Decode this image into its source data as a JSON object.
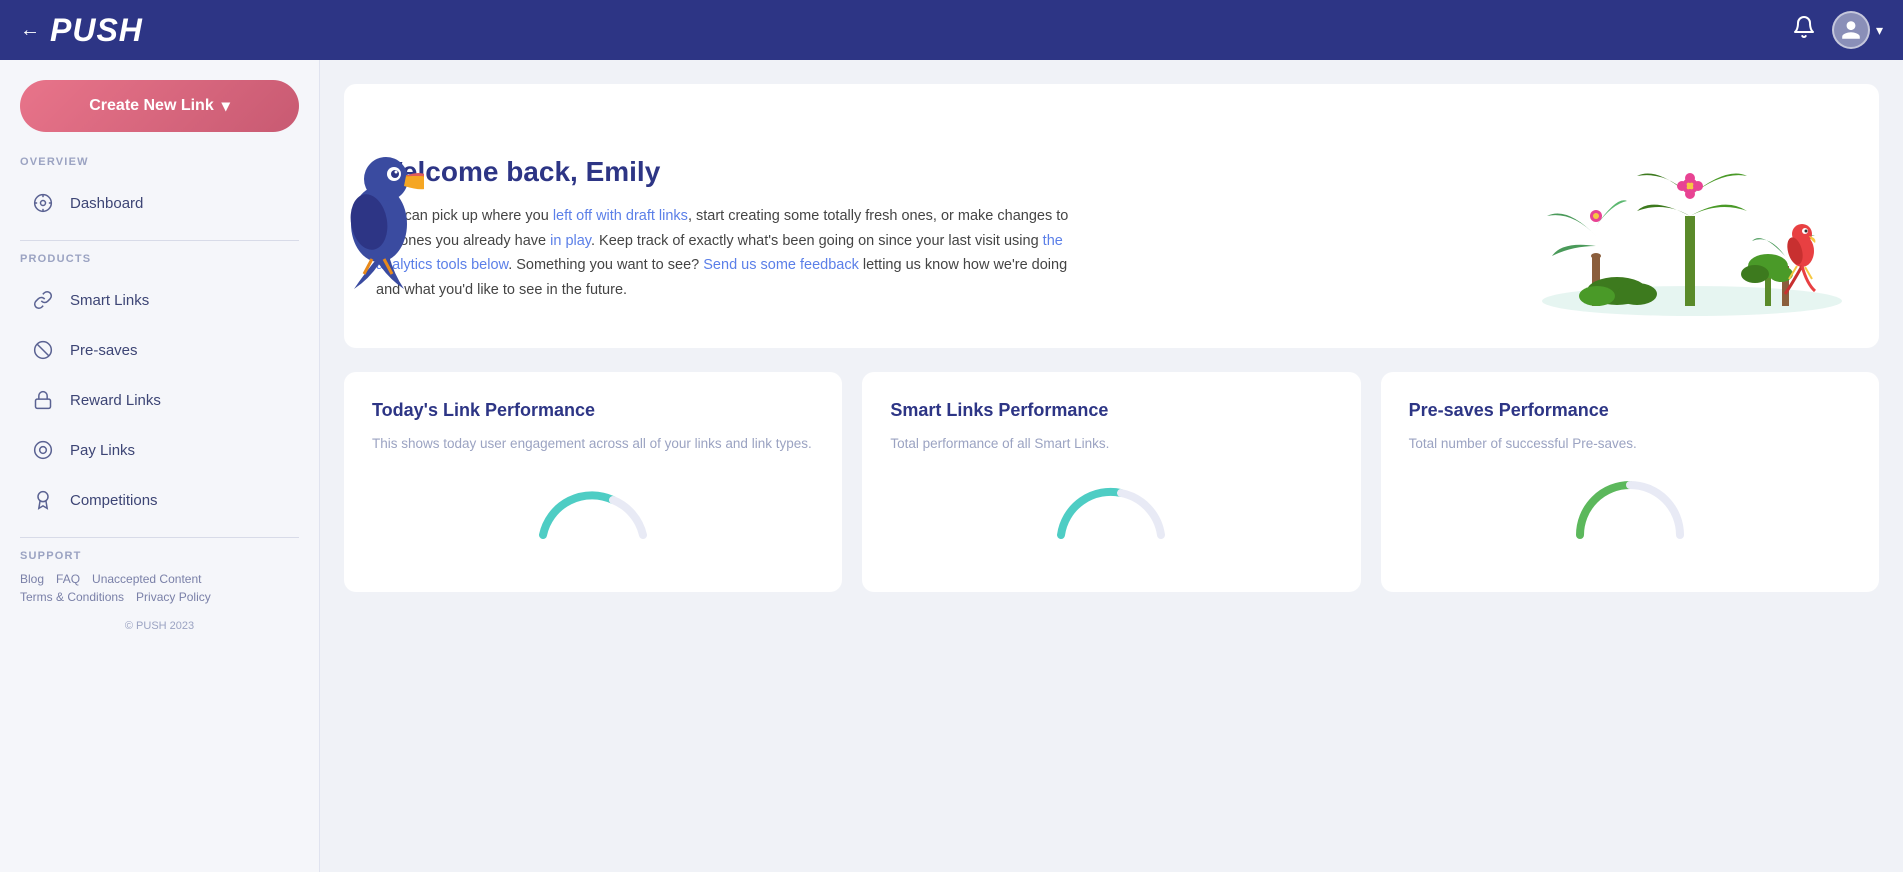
{
  "header": {
    "back_label": "←",
    "logo": "PUSH",
    "bell_icon": "🔔",
    "avatar_icon": "👤",
    "chevron": "▾"
  },
  "sidebar": {
    "create_button_label": "Create New Link",
    "create_chevron": "▾",
    "overview_label": "OVERVIEW",
    "items_overview": [
      {
        "id": "dashboard",
        "label": "Dashboard",
        "icon": "⊙"
      }
    ],
    "products_label": "PRODUCTS",
    "items_products": [
      {
        "id": "smart-links",
        "label": "Smart Links",
        "icon": "🔗"
      },
      {
        "id": "pre-saves",
        "label": "Pre-saves",
        "icon": "⊘"
      },
      {
        "id": "reward-links",
        "label": "Reward Links",
        "icon": "🔒"
      },
      {
        "id": "pay-links",
        "label": "Pay Links",
        "icon": "⊙"
      },
      {
        "id": "competitions",
        "label": "Competitions",
        "icon": "🏆"
      }
    ],
    "support_label": "SUPPORT",
    "support_links": [
      {
        "id": "blog",
        "label": "Blog"
      },
      {
        "id": "faq",
        "label": "FAQ"
      },
      {
        "id": "unaccepted-content",
        "label": "Unaccepted Content"
      },
      {
        "id": "terms",
        "label": "Terms & Conditions"
      },
      {
        "id": "privacy",
        "label": "Privacy Policy"
      }
    ],
    "copyright": "© PUSH 2023"
  },
  "welcome": {
    "title": "Welcome back, Emily",
    "text_line1": "You can pick up where you left off with draft links, start creating some totally fresh",
    "text_line2": "ones, or make changes to the ones you already have in play. Keep track of exactly",
    "text_line3": "what's been going on since your last visit using the analytics tools below.",
    "text_line4": "Something you want to see? Send us some feedback letting us know how we're",
    "text_line5": "doing and what you'd like to see in the future."
  },
  "cards": [
    {
      "id": "today-link-performance",
      "title": "Today's Link Performance",
      "description": "This shows today user engagement across all of your links and link types.",
      "chart_color": "#4ecdc4"
    },
    {
      "id": "smart-links-performance",
      "title": "Smart Links Performance",
      "description": "Total performance of all Smart Links.",
      "chart_color": "#4ecdc4"
    },
    {
      "id": "pre-saves-performance",
      "title": "Pre-saves Performance",
      "description": "Total number of successful Pre-saves.",
      "chart_color": "#5cb85c"
    }
  ]
}
